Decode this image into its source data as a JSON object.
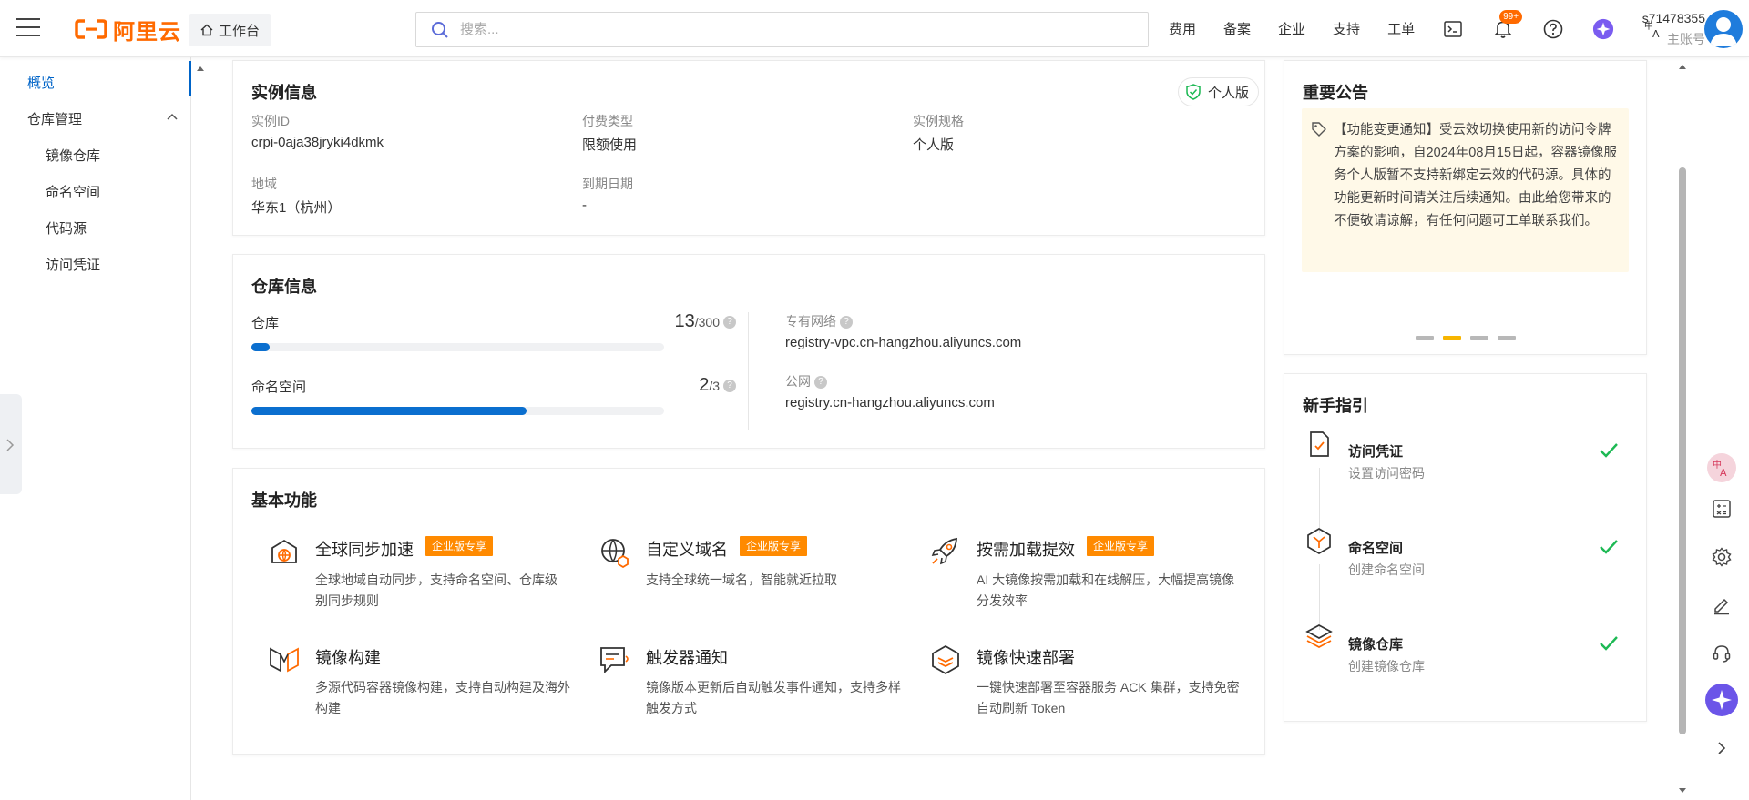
{
  "header": {
    "logo_text": "阿里云",
    "workbench_label": "工作台",
    "search_placeholder": "搜索...",
    "nav": [
      "费用",
      "备案",
      "企业",
      "支持",
      "工单"
    ],
    "notification_badge": "99+",
    "account_id": "s71478355",
    "account_role": "主账号",
    "brand_color": "#ff6a00"
  },
  "sidebar": {
    "overview": "概览",
    "repo_mgmt": "仓库管理",
    "items": [
      "镜像仓库",
      "命名空间",
      "代码源",
      "访问凭证"
    ],
    "active_color": "#0064c8"
  },
  "instance": {
    "title": "实例信息",
    "edition_tag": "个人版",
    "fields": [
      {
        "label": "实例ID",
        "value": "crpi-0aja38jryki4dkmk"
      },
      {
        "label": "付费类型",
        "value": "限额使用"
      },
      {
        "label": "实例规格",
        "value": "个人版"
      },
      {
        "label": "地域",
        "value": "华东1（杭州）"
      },
      {
        "label": "到期日期",
        "value": "-"
      }
    ]
  },
  "repo_info": {
    "title": "仓库信息",
    "repo_label": "仓库",
    "repo_used": "13",
    "repo_total": "/300",
    "repo_fraction": 0.0433,
    "ns_label": "命名空间",
    "ns_used": "2",
    "ns_total": "/3",
    "ns_fraction": 0.6667,
    "vpc_label": "专有网络",
    "vpc_value": "registry-vpc.cn-hangzhou.aliyuncs.com",
    "public_label": "公网",
    "public_value": "registry.cn-hangzhou.aliyuncs.com"
  },
  "features": {
    "title": "基本功能",
    "enterprise_tag": "企业版专享",
    "items": [
      {
        "name": "全球同步加速",
        "desc": "全球地域自动同步，支持命名空间、仓库级别同步规则",
        "enterprise": true,
        "icon": "global-sync-icon"
      },
      {
        "name": "自定义域名",
        "desc": "支持全球统一域名，智能就近拉取",
        "enterprise": true,
        "icon": "custom-domain-icon"
      },
      {
        "name": "按需加载提效",
        "desc": "AI 大镜像按需加载和在线解压，大幅提高镜像分发效率",
        "enterprise": true,
        "icon": "rocket-icon"
      },
      {
        "name": "镜像构建",
        "desc": "多源代码容器镜像构建，支持自动构建及海外构建",
        "enterprise": false,
        "icon": "image-build-icon"
      },
      {
        "name": "触发器通知",
        "desc": "镜像版本更新后自动触发事件通知，支持多样触发方式",
        "enterprise": false,
        "icon": "trigger-notify-icon"
      },
      {
        "name": "镜像快速部署",
        "desc": "一键快速部署至容器服务 ACK 集群，支持免密自动刷新 Token",
        "enterprise": false,
        "icon": "deploy-icon"
      }
    ]
  },
  "notice": {
    "title": "重要公告",
    "text": "【功能变更通知】受云效切换使用新的访问令牌方案的影响，自2024年08月15日起，容器镜像服务个人版暂不支持新绑定云效的代码源。具体的功能更新时间请关注后续通知。由此给您带来的不便敬请谅解，有任何问题可工单联系我们。"
  },
  "guide": {
    "title": "新手指引",
    "steps": [
      {
        "title": "访问凭证",
        "sub": "设置访问密码",
        "icon": "credential-icon"
      },
      {
        "title": "命名空间",
        "sub": "创建命名空间",
        "icon": "namespace-icon"
      },
      {
        "title": "镜像仓库",
        "sub": "创建镜像仓库",
        "icon": "repository-icon"
      }
    ],
    "done_color": "#1db954"
  }
}
